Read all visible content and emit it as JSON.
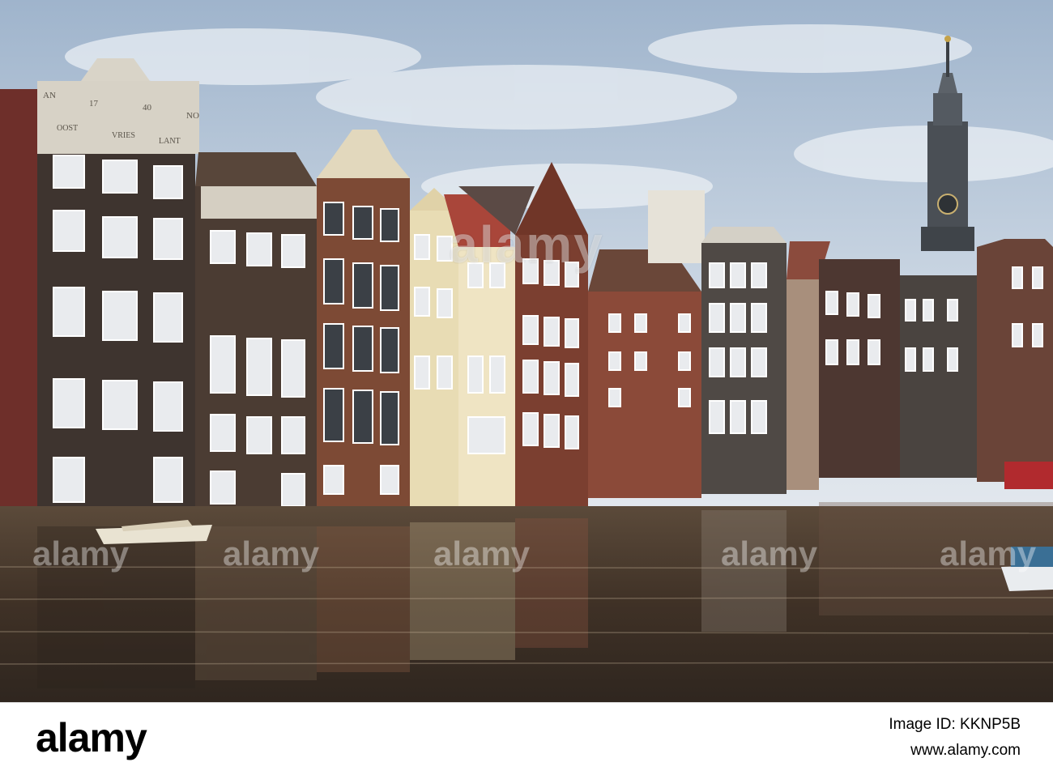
{
  "photo": {
    "building_signs": {
      "left": "AN",
      "year_part1": "17",
      "year_part2": "40",
      "right": "NO",
      "lower_left": "OOST",
      "lower_mid": "VRIES",
      "lower_right": "LANT"
    },
    "colors": {
      "sky_top": "#9fb4cc",
      "sky_bottom": "#dfe6ee",
      "water": "#4a3a2c",
      "brick_dark": "#3d332d",
      "brick_red": "#7a3b2c",
      "cream": "#e6d9b8"
    }
  },
  "watermark": {
    "center": "alamy",
    "row": [
      "alamy",
      "alamy",
      "alamy",
      "alamy",
      "alamy"
    ]
  },
  "footer": {
    "logo": "alamy",
    "image_id": "Image ID: KKNP5B",
    "url": "www.alamy.com"
  }
}
